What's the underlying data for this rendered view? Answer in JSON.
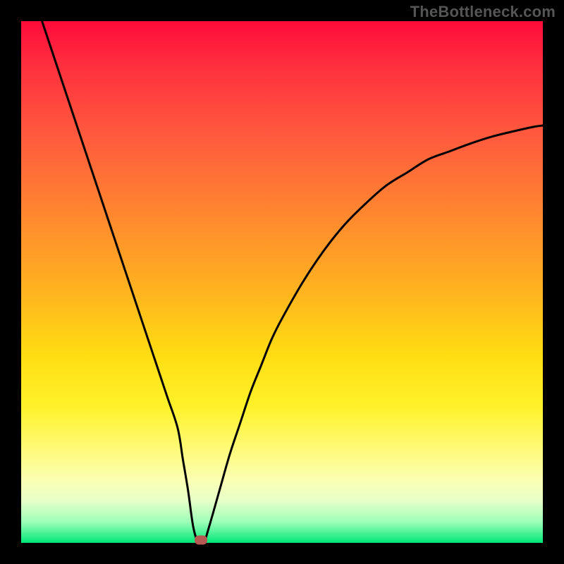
{
  "watermark": "TheBottleneck.com",
  "chart_data": {
    "type": "line",
    "title": "",
    "xlabel": "",
    "ylabel": "",
    "xlim": [
      0,
      100
    ],
    "ylim": [
      0,
      100
    ],
    "grid": false,
    "series": [
      {
        "name": "curve",
        "x": [
          4,
          6,
          8,
          10,
          12,
          14,
          16,
          18,
          20,
          22,
          24,
          26,
          28,
          30,
          31,
          32,
          33,
          34,
          35,
          36,
          38,
          40,
          42,
          44,
          46,
          48,
          50,
          54,
          58,
          62,
          66,
          70,
          74,
          78,
          82,
          86,
          90,
          94,
          98,
          100
        ],
        "y": [
          100,
          94,
          88,
          82,
          76,
          70,
          64,
          58,
          52,
          46,
          40,
          34,
          28,
          22,
          16,
          10,
          3,
          0,
          0,
          3,
          10,
          17,
          23,
          29,
          34,
          39,
          43,
          50,
          56,
          61,
          65,
          68.5,
          71,
          73.5,
          75,
          76.5,
          77.8,
          78.8,
          79.7,
          80
        ]
      }
    ],
    "marker": {
      "x": 34.5,
      "y": 0
    },
    "background_gradient": {
      "stops": [
        {
          "offset": 0,
          "color": "#ff0a3a"
        },
        {
          "offset": 0.5,
          "color": "#ffdd12"
        },
        {
          "offset": 0.9,
          "color": "#fbffb4"
        },
        {
          "offset": 1,
          "color": "#00e676"
        }
      ]
    }
  }
}
